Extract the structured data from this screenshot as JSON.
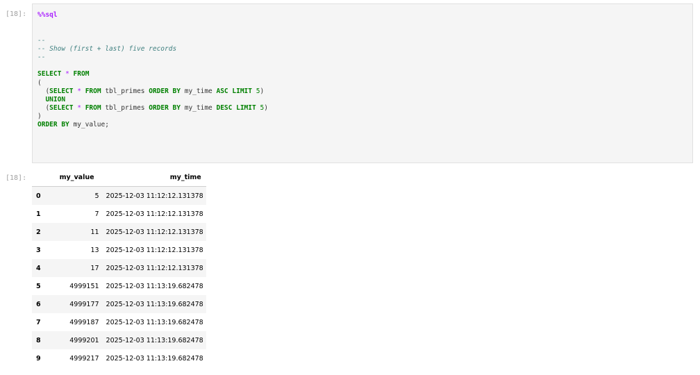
{
  "input_cell": {
    "prompt": "[18]:",
    "lines": [
      [
        {
          "t": "magic",
          "v": "%%sql"
        }
      ],
      [],
      [],
      [
        {
          "t": "cmt",
          "v": "--"
        }
      ],
      [
        {
          "t": "cmt",
          "v": "-- Show (first + last) five records"
        }
      ],
      [
        {
          "t": "cmt",
          "v": "--"
        }
      ],
      [],
      [
        {
          "t": "kw",
          "v": "SELECT"
        },
        {
          "t": "plain",
          "v": " "
        },
        {
          "t": "op",
          "v": "*"
        },
        {
          "t": "plain",
          "v": " "
        },
        {
          "t": "kw",
          "v": "FROM"
        }
      ],
      [
        {
          "t": "plain",
          "v": "("
        }
      ],
      [
        {
          "t": "plain",
          "v": "  ("
        },
        {
          "t": "kw",
          "v": "SELECT"
        },
        {
          "t": "plain",
          "v": " "
        },
        {
          "t": "op",
          "v": "*"
        },
        {
          "t": "plain",
          "v": " "
        },
        {
          "t": "kw",
          "v": "FROM"
        },
        {
          "t": "plain",
          "v": " tbl_primes "
        },
        {
          "t": "kw",
          "v": "ORDER BY"
        },
        {
          "t": "plain",
          "v": " my_time "
        },
        {
          "t": "kw",
          "v": "ASC"
        },
        {
          "t": "plain",
          "v": " "
        },
        {
          "t": "kw",
          "v": "LIMIT"
        },
        {
          "t": "plain",
          "v": " "
        },
        {
          "t": "num",
          "v": "5"
        },
        {
          "t": "plain",
          "v": ")"
        }
      ],
      [
        {
          "t": "plain",
          "v": "  "
        },
        {
          "t": "kw",
          "v": "UNION"
        }
      ],
      [
        {
          "t": "plain",
          "v": "  ("
        },
        {
          "t": "kw",
          "v": "SELECT"
        },
        {
          "t": "plain",
          "v": " "
        },
        {
          "t": "op",
          "v": "*"
        },
        {
          "t": "plain",
          "v": " "
        },
        {
          "t": "kw",
          "v": "FROM"
        },
        {
          "t": "plain",
          "v": " tbl_primes "
        },
        {
          "t": "kw",
          "v": "ORDER BY"
        },
        {
          "t": "plain",
          "v": " my_time "
        },
        {
          "t": "kw",
          "v": "DESC"
        },
        {
          "t": "plain",
          "v": " "
        },
        {
          "t": "kw",
          "v": "LIMIT"
        },
        {
          "t": "plain",
          "v": " "
        },
        {
          "t": "num",
          "v": "5"
        },
        {
          "t": "plain",
          "v": ")"
        }
      ],
      [
        {
          "t": "plain",
          "v": ")"
        }
      ],
      [
        {
          "t": "kw",
          "v": "ORDER BY"
        },
        {
          "t": "plain",
          "v": " my_value;"
        }
      ]
    ]
  },
  "output_cell": {
    "prompt": "[18]:",
    "table": {
      "columns": [
        "my_value",
        "my_time"
      ],
      "rows": [
        {
          "index": "0",
          "my_value": "5",
          "my_time": "2025-12-03 11:12:12.131378"
        },
        {
          "index": "1",
          "my_value": "7",
          "my_time": "2025-12-03 11:12:12.131378"
        },
        {
          "index": "2",
          "my_value": "11",
          "my_time": "2025-12-03 11:12:12.131378"
        },
        {
          "index": "3",
          "my_value": "13",
          "my_time": "2025-12-03 11:12:12.131378"
        },
        {
          "index": "4",
          "my_value": "17",
          "my_time": "2025-12-03 11:12:12.131378"
        },
        {
          "index": "5",
          "my_value": "4999151",
          "my_time": "2025-12-03 11:13:19.682478"
        },
        {
          "index": "6",
          "my_value": "4999177",
          "my_time": "2025-12-03 11:13:19.682478"
        },
        {
          "index": "7",
          "my_value": "4999187",
          "my_time": "2025-12-03 11:13:19.682478"
        },
        {
          "index": "8",
          "my_value": "4999201",
          "my_time": "2025-12-03 11:13:19.682478"
        },
        {
          "index": "9",
          "my_value": "4999217",
          "my_time": "2025-12-03 11:13:19.682478"
        }
      ]
    }
  },
  "colors": {
    "cell_background": "#f5f5f5",
    "keyword": "#008000",
    "comment": "#408080",
    "magic": "#aa22ff",
    "operator": "#aa22ff",
    "prompt": "#a0a0a0"
  }
}
